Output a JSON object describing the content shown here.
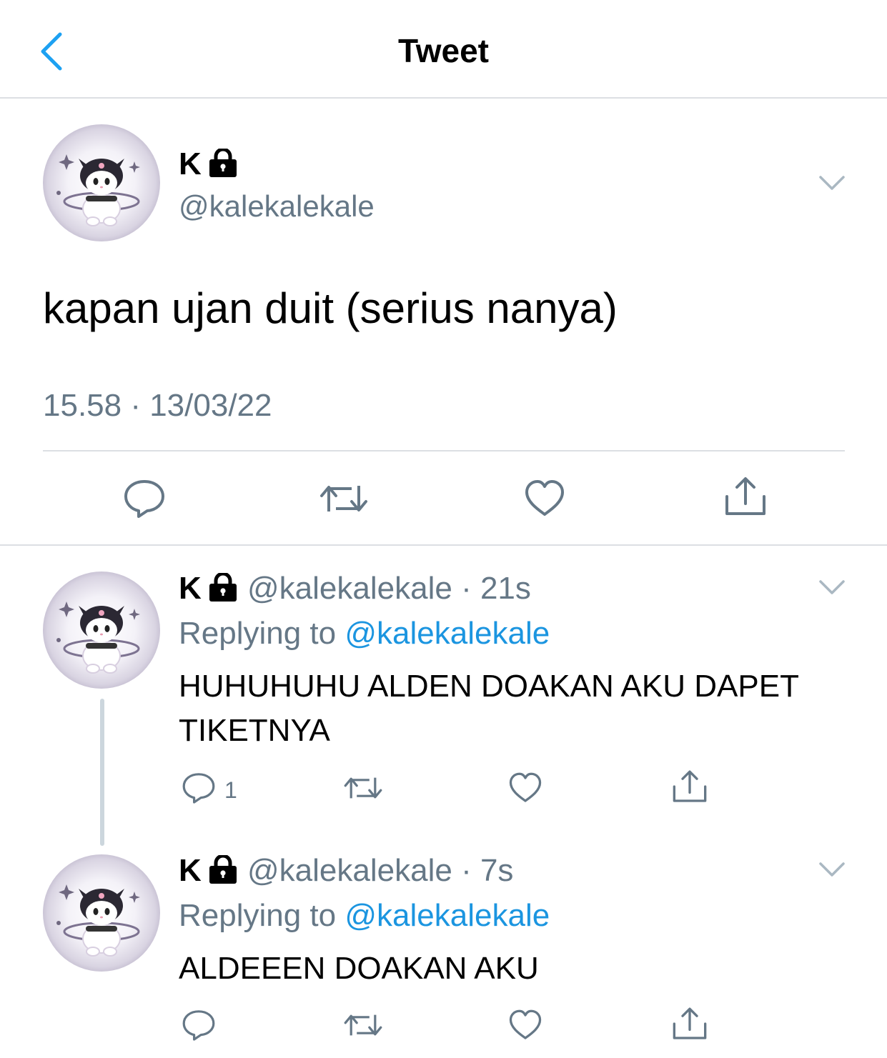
{
  "header": {
    "title": "Tweet",
    "back_icon": "chevron-left-icon",
    "accent": "#1da1f2"
  },
  "main_tweet": {
    "name": "K",
    "handle": "@kalekalekale",
    "text": "kapan ujan duit (serius nanya)",
    "timestamp": "15.58 · 13/03/22",
    "actions": [
      "reply-icon",
      "retweet-icon",
      "like-icon",
      "share-icon"
    ]
  },
  "replies": [
    {
      "name": "K",
      "handle": "@kalekalekale",
      "time": "· 21s",
      "replying_label": "Replying to",
      "replying_to": "@kalekalekale",
      "text": "HUHUHUHU ALDEN DOAKAN AKU DAPET TIKETNYA",
      "reply_count": "1"
    },
    {
      "name": "K",
      "handle": "@kalekalekale",
      "time": "· 7s",
      "replying_label": "Replying to",
      "replying_to": "@kalekalekale",
      "text": "ALDEEEN DOAKAN AKU",
      "reply_count": ""
    }
  ],
  "colors": {
    "secondary_text": "#657786",
    "link": "#1b95e0",
    "divider": "#dcdfe3",
    "icon": "#657786"
  }
}
